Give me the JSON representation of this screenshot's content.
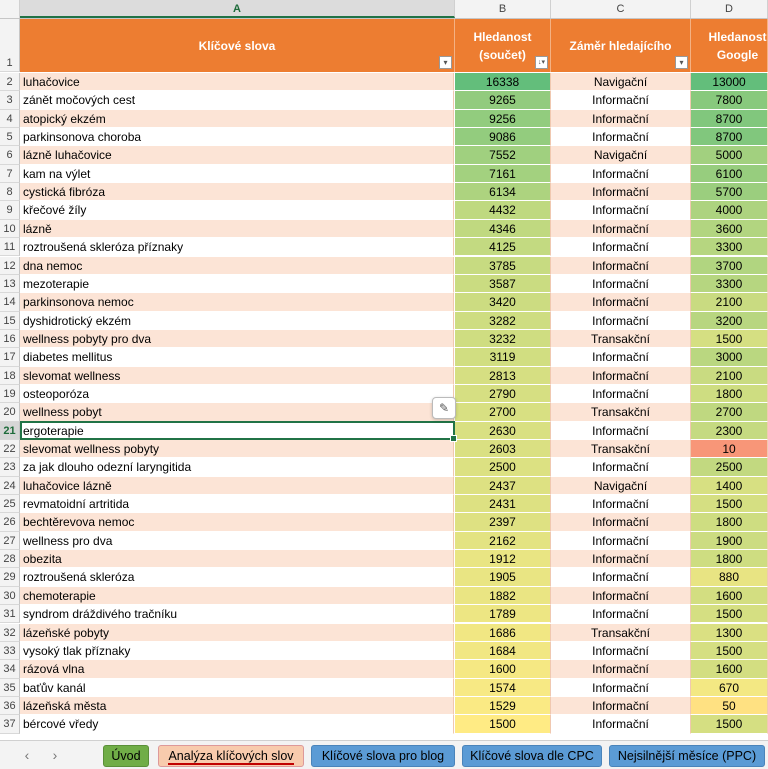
{
  "column_headers": [
    "A",
    "B",
    "C",
    "D"
  ],
  "active_column": "A",
  "header_row": {
    "row_number": "1",
    "a": "Klíčové slova",
    "b": "Hledanost (součet)",
    "c": "Záměr hledajícího",
    "d": "Hledanost Google"
  },
  "colors": {
    "header_bg": "#ed7d31",
    "band_odd": "#fce4d6",
    "band_even": "#ffffff",
    "scale_high": "#63be7b",
    "scale_mid": "#ffeb84",
    "scale_low": "#f8696b"
  },
  "active_row": "21",
  "rows": [
    {
      "n": "2",
      "kw": "luhačovice",
      "b": "16338",
      "c": "Navigační",
      "d": "13000"
    },
    {
      "n": "3",
      "kw": "zánět močových cest",
      "b": "9265",
      "c": "Informační",
      "d": "7800"
    },
    {
      "n": "4",
      "kw": "atopický ekzém",
      "b": "9256",
      "c": "Informační",
      "d": "8700"
    },
    {
      "n": "5",
      "kw": "parkinsonova choroba",
      "b": "9086",
      "c": "Informační",
      "d": "8700"
    },
    {
      "n": "6",
      "kw": "lázně luhačovice",
      "b": "7552",
      "c": "Navigační",
      "d": "5000"
    },
    {
      "n": "7",
      "kw": "kam na výlet",
      "b": "7161",
      "c": "Informační",
      "d": "6100"
    },
    {
      "n": "8",
      "kw": "cystická fibróza",
      "b": "6134",
      "c": "Informační",
      "d": "5700"
    },
    {
      "n": "9",
      "kw": "křečové žíly",
      "b": "4432",
      "c": "Informační",
      "d": "4000"
    },
    {
      "n": "10",
      "kw": "lázně",
      "b": "4346",
      "c": "Informační",
      "d": "3600"
    },
    {
      "n": "11",
      "kw": "roztroušená skleróza příznaky",
      "b": "4125",
      "c": "Informační",
      "d": "3300"
    },
    {
      "n": "12",
      "kw": "dna nemoc",
      "b": "3785",
      "c": "Informační",
      "d": "3700"
    },
    {
      "n": "13",
      "kw": "mezoterapie",
      "b": "3587",
      "c": "Informační",
      "d": "3300"
    },
    {
      "n": "14",
      "kw": "parkinsonova nemoc",
      "b": "3420",
      "c": "Informační",
      "d": "2100"
    },
    {
      "n": "15",
      "kw": "dyshidrotický ekzém",
      "b": "3282",
      "c": "Informační",
      "d": "3200"
    },
    {
      "n": "16",
      "kw": "wellness pobyty pro dva",
      "b": "3232",
      "c": "Transakční",
      "d": "1500"
    },
    {
      "n": "17",
      "kw": "diabetes mellitus",
      "b": "3119",
      "c": "Informační",
      "d": "3000"
    },
    {
      "n": "18",
      "kw": "slevomat wellness",
      "b": "2813",
      "c": "Informační",
      "d": "2100"
    },
    {
      "n": "19",
      "kw": "osteoporóza",
      "b": "2790",
      "c": "Informační",
      "d": "1800"
    },
    {
      "n": "20",
      "kw": "wellness pobyt",
      "b": "2700",
      "c": "Transakční",
      "d": "2700"
    },
    {
      "n": "21",
      "kw": "ergoterapie",
      "b": "2630",
      "c": "Informační",
      "d": "2300"
    },
    {
      "n": "22",
      "kw": "slevomat wellness pobyty",
      "b": "2603",
      "c": "Transakční",
      "d": "10"
    },
    {
      "n": "23",
      "kw": "za jak dlouho odezní laryngitida",
      "b": "2500",
      "c": "Informační",
      "d": "2500"
    },
    {
      "n": "24",
      "kw": "luhačovice lázně",
      "b": "2437",
      "c": "Navigační",
      "d": "1400"
    },
    {
      "n": "25",
      "kw": "revmatoidní artritida",
      "b": "2431",
      "c": "Informační",
      "d": "1500"
    },
    {
      "n": "26",
      "kw": "bechtěrevova nemoc",
      "b": "2397",
      "c": "Informační",
      "d": "1800"
    },
    {
      "n": "27",
      "kw": "wellness pro dva",
      "b": "2162",
      "c": "Informační",
      "d": "1900"
    },
    {
      "n": "28",
      "kw": "obezita",
      "b": "1912",
      "c": "Informační",
      "d": "1800"
    },
    {
      "n": "29",
      "kw": "roztroušená skleróza",
      "b": "1905",
      "c": "Informační",
      "d": "880"
    },
    {
      "n": "30",
      "kw": "chemoterapie",
      "b": "1882",
      "c": "Informační",
      "d": "1600"
    },
    {
      "n": "31",
      "kw": "syndrom dráždivého tračníku",
      "b": "1789",
      "c": "Informační",
      "d": "1500"
    },
    {
      "n": "32",
      "kw": "lázeňské pobyty",
      "b": "1686",
      "c": "Transakční",
      "d": "1300"
    },
    {
      "n": "33",
      "kw": "vysoký tlak příznaky",
      "b": "1684",
      "c": "Informační",
      "d": "1500"
    },
    {
      "n": "34",
      "kw": "rázová vlna",
      "b": "1600",
      "c": "Informační",
      "d": "1600"
    },
    {
      "n": "35",
      "kw": "baťův kanál",
      "b": "1574",
      "c": "Informační",
      "d": "670"
    },
    {
      "n": "36",
      "kw": "lázeňská města",
      "b": "1529",
      "c": "Informační",
      "d": "50"
    },
    {
      "n": "37",
      "kw": "bércové vředy",
      "b": "1500",
      "c": "Informační",
      "d": "1500"
    }
  ],
  "sheet_tabs": [
    {
      "label": "Úvod",
      "style": "green"
    },
    {
      "label": "Analýza klíčových slov",
      "style": "pink",
      "active": true
    },
    {
      "label": "Klíčové slova pro blog",
      "style": "blue"
    },
    {
      "label": "Klíčové slova dle CPC",
      "style": "blue"
    },
    {
      "label": "Nejsilnější měsíce (PPC)",
      "style": "blue"
    }
  ],
  "icons": {
    "prev_sheet": "‹",
    "next_sheet": "›",
    "filter": "▾",
    "sort_filter": "↓▾",
    "quick_analysis": "✎"
  }
}
